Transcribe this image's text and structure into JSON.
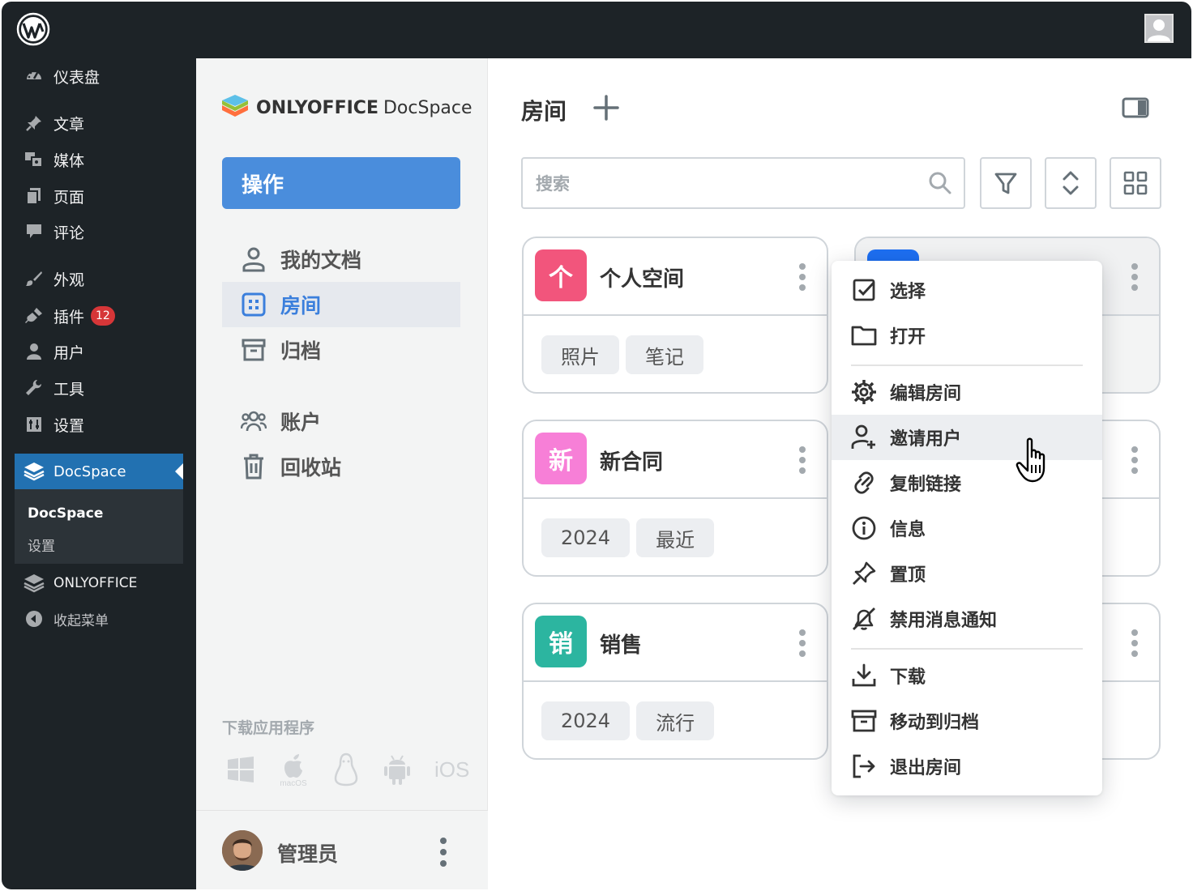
{
  "wp": {
    "menu": [
      {
        "label": "仪表盘",
        "icon": "dashboard-icon"
      },
      {
        "label": "文章",
        "icon": "pin-icon"
      },
      {
        "label": "媒体",
        "icon": "media-icon"
      },
      {
        "label": "页面",
        "icon": "pages-icon"
      },
      {
        "label": "评论",
        "icon": "comment-icon"
      },
      {
        "label": "外观",
        "icon": "brush-icon"
      },
      {
        "label": "插件",
        "icon": "plugin-icon",
        "badge": "12"
      },
      {
        "label": "用户",
        "icon": "user-icon"
      },
      {
        "label": "工具",
        "icon": "wrench-icon"
      },
      {
        "label": "设置",
        "icon": "settings-icon"
      }
    ],
    "active": {
      "label": "DocSpace",
      "icon": "layers-icon"
    },
    "submenu": [
      "DocSpace",
      "设置"
    ],
    "onlyoffice": "ONLYOFFICE",
    "collapse": "收起菜单"
  },
  "docspace": {
    "logo_bold": "ONLYOFFICE",
    "logo_light": "DocSpace",
    "action_label": "操作",
    "nav": [
      {
        "label": "我的文档",
        "icon": "person-icon"
      },
      {
        "label": "房间",
        "icon": "rooms-icon",
        "active": true
      },
      {
        "label": "归档",
        "icon": "archive-icon"
      },
      {
        "label": "账户",
        "icon": "accounts-icon"
      },
      {
        "label": "回收站",
        "icon": "trash-icon"
      }
    ],
    "download_label": "下载应用程序",
    "apps": [
      "windows",
      "macOS",
      "linux",
      "android",
      "iOS"
    ],
    "user": "管理员"
  },
  "main": {
    "title": "房间",
    "search_placeholder": "搜索",
    "rooms": [
      {
        "logo": "个",
        "name": "个人空间",
        "color": "#f2557c",
        "tags": [
          "照片",
          "笔记"
        ]
      },
      {
        "logo": "新",
        "name": "新合同",
        "color": "#f77fd7",
        "tags": [
          "2024",
          "最近"
        ]
      },
      {
        "logo": "销",
        "name": "销售",
        "color": "#2cb5a0",
        "tags": [
          "2024",
          "流行"
        ]
      }
    ],
    "room_accent": "#1d6ff2"
  },
  "context_menu": {
    "items": [
      {
        "label": "选择",
        "icon": "checkbox-icon"
      },
      {
        "label": "打开",
        "icon": "folder-icon"
      },
      {
        "label": "编辑房间",
        "icon": "gear-icon"
      },
      {
        "label": "邀请用户",
        "icon": "add-user-icon",
        "hover": true
      },
      {
        "label": "复制链接",
        "icon": "link-icon"
      },
      {
        "label": "信息",
        "icon": "info-icon"
      },
      {
        "label": "置顶",
        "icon": "pin-icon"
      },
      {
        "label": "禁用消息通知",
        "icon": "bell-off-icon"
      },
      {
        "label": "下载",
        "icon": "download-icon"
      },
      {
        "label": "移动到归档",
        "icon": "archive-icon"
      },
      {
        "label": "退出房间",
        "icon": "exit-icon"
      }
    ]
  }
}
